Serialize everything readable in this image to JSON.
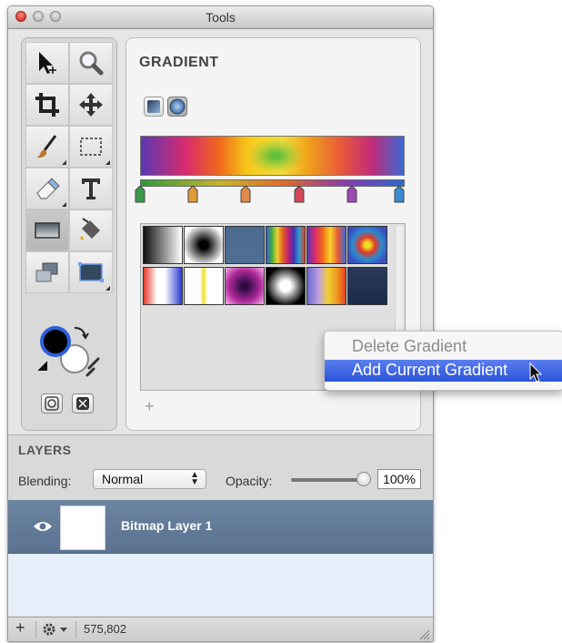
{
  "window": {
    "title": "Tools"
  },
  "toolbox": {
    "tools": [
      {
        "name": "move-select-tool",
        "icon": "arrow-move-icon"
      },
      {
        "name": "zoom-tool",
        "icon": "magnifier-icon"
      },
      {
        "name": "crop-tool",
        "icon": "crop-icon"
      },
      {
        "name": "pan-tool",
        "icon": "move-arrows-icon"
      },
      {
        "name": "brush-tool",
        "icon": "brush-icon"
      },
      {
        "name": "marquee-tool",
        "icon": "marquee-icon"
      },
      {
        "name": "eraser-tool",
        "icon": "eraser-icon"
      },
      {
        "name": "text-tool",
        "icon": "text-icon"
      },
      {
        "name": "gradient-tool",
        "icon": "gradient-icon",
        "selected": true
      },
      {
        "name": "fill-tool",
        "icon": "paint-bucket-icon"
      },
      {
        "name": "shape-tool",
        "icon": "shapes-icon"
      },
      {
        "name": "rect-tool",
        "icon": "rectangle-icon"
      }
    ],
    "foreground_color": "#000000",
    "background_color": "#ffffff"
  },
  "gradient_panel": {
    "title": "GRADIENT",
    "modes": [
      "linear-gradient-icon",
      "radial-gradient-icon"
    ],
    "stop_colors": [
      "#3a9a4a",
      "#e09a3a",
      "#e08a4a",
      "#d04a5a",
      "#9a4ab0",
      "#3a8ad0"
    ],
    "add_label": "+"
  },
  "context_menu": {
    "items": [
      {
        "label": "Delete Gradient",
        "enabled": false
      },
      {
        "label": "Add Current Gradient",
        "enabled": true,
        "highlighted": true
      }
    ]
  },
  "layers": {
    "title": "LAYERS",
    "blending_label": "Blending:",
    "blending_value": "Normal",
    "opacity_label": "Opacity:",
    "opacity_value": "100%",
    "opacity_level": 1.0,
    "items": [
      {
        "name": "Bitmap Layer 1",
        "visible": true,
        "selected": true
      }
    ]
  },
  "status": {
    "add_label": "+",
    "coords": "575,802"
  }
}
